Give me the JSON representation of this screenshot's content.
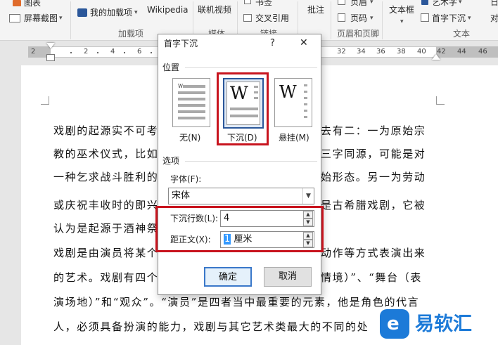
{
  "ribbon": {
    "chart_label": "图表",
    "screenshot_label": "屏幕截图",
    "my_addins_label": "我的加载项",
    "wikipedia_label": "Wikipedia",
    "addins_group": "加载项",
    "online_video_label": "联机视频",
    "media_group_partial": "媒体",
    "bookmark_label": "书签",
    "crossref_label": "交叉引用",
    "links_group_partial": "链接",
    "comment_label": "批注",
    "header_label": "页眉",
    "page_number_label": "页码",
    "header_footer_group": "页眉和页脚",
    "textbox_label": "文本框",
    "wordart_label": "艺术字",
    "dropcap_label": "首字下沉",
    "text_group": "文本",
    "right_partial_top": "日",
    "right_partial_mid": "对"
  },
  "ruler": {
    "left_numbers": [
      "2",
      "2",
      "4",
      "6"
    ],
    "right_numbers": [
      "32",
      "34",
      "36",
      "38",
      "40",
      "42",
      "44",
      "46"
    ]
  },
  "document": {
    "lines": [
      "戏剧的起源实不可考",
      "教的巫术仪式，比如",
      "一种乞求战斗胜利的",
      "或庆祝丰收时的即兴",
      "认为是起源于酒神祭",
      "戏剧是由演员将某个",
      "的艺术。戏剧有四个",
      "演场地）”和“观众”。“演员”是四者当中最重要的元素，他是角色的代言",
      "人，必须具备扮演的能力，戏剧与其它艺术类最大的不同的处"
    ],
    "lines_right": [
      "去有二：一为原始宗",
      "三字同源，可能是对",
      "始形态。另一为劳动",
      "是古希腊戏剧，它被",
      "",
      "动作等方式表演出来",
      "情境）”、“舞台（表"
    ]
  },
  "dialog": {
    "title": "首字下沉",
    "help": "?",
    "close": "✕",
    "position_section": "位置",
    "options": [
      {
        "label": "无(N)",
        "glyph": "W"
      },
      {
        "label": "下沉(D)",
        "glyph": "W"
      },
      {
        "label": "悬挂(M)",
        "glyph": "W"
      }
    ],
    "options_section": "选项",
    "font_label": "字体(F):",
    "font_value": "宋体",
    "lines_label": "下沉行数(L):",
    "lines_value": "4",
    "distance_label": "距正文(X):",
    "distance_number": "1",
    "distance_unit": "厘米",
    "ok": "确定",
    "cancel": "取消"
  },
  "watermark": {
    "text": "易软汇"
  },
  "colors": {
    "highlight": "#c8141e",
    "accent": "#2b579a"
  }
}
